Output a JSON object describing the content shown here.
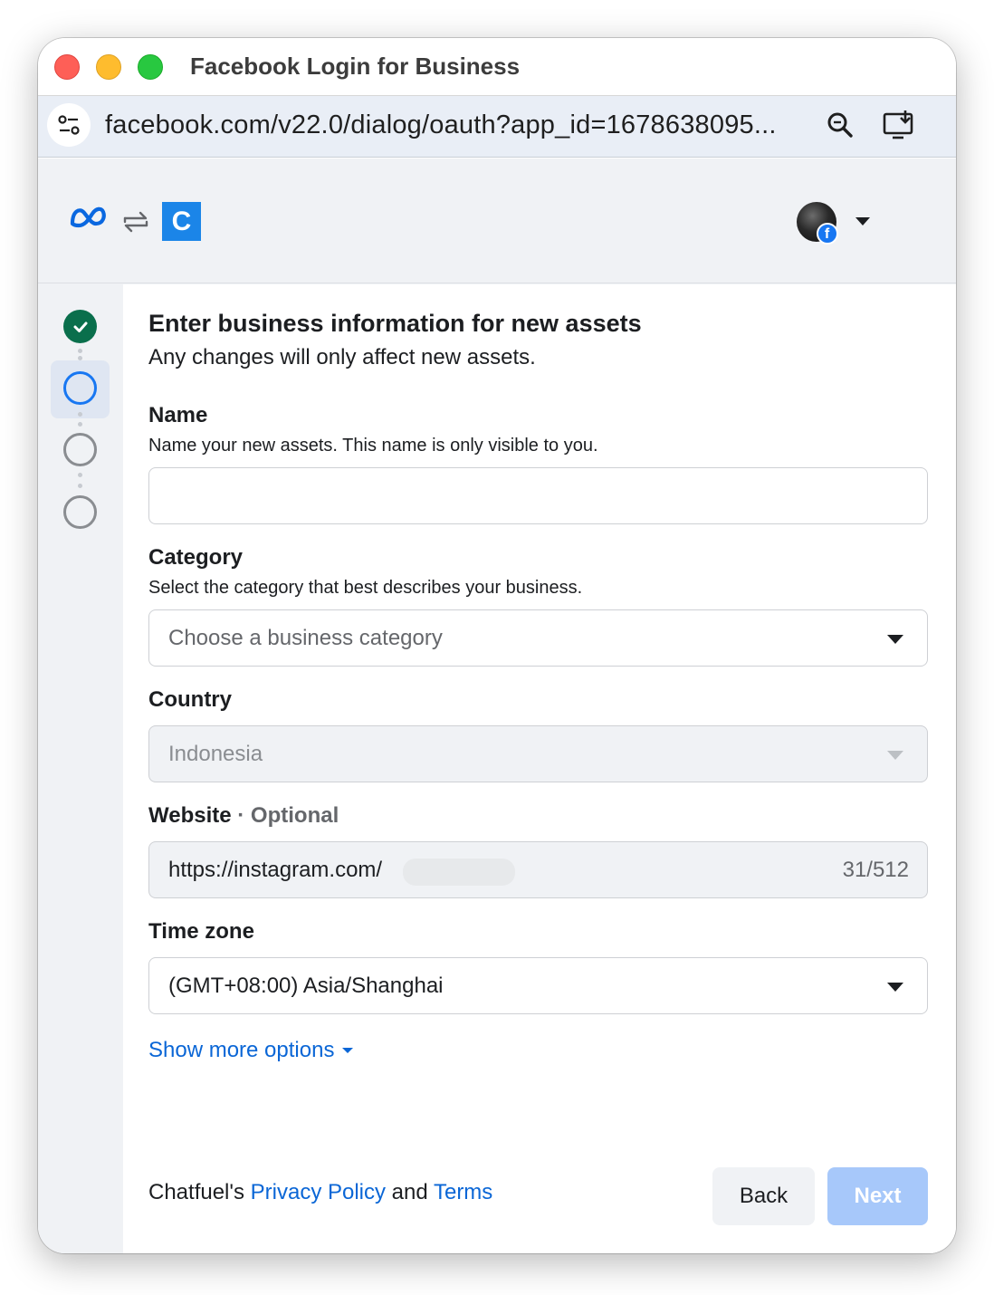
{
  "window": {
    "title": "Facebook Login for Business",
    "url": "facebook.com/v22.0/dialog/oauth?app_id=1678638095..."
  },
  "header": {
    "app_logo_letter": "C"
  },
  "form": {
    "heading": "Enter business information for new assets",
    "subheading": "Any changes will only affect new assets.",
    "name": {
      "label": "Name",
      "help": "Name your new assets. This name is only visible to you.",
      "value": ""
    },
    "category": {
      "label": "Category",
      "help": "Select the category that best describes your business.",
      "placeholder": "Choose a business category"
    },
    "country": {
      "label": "Country",
      "value": "Indonesia"
    },
    "website": {
      "label": "Website",
      "separator": " · ",
      "optional": "Optional",
      "value": "https://instagram.com/",
      "counter": "31/512"
    },
    "timezone": {
      "label": "Time zone",
      "value": "(GMT+08:00) Asia/Shanghai"
    },
    "show_more": "Show more options"
  },
  "footer": {
    "prefix": "Chatfuel's ",
    "privacy": "Privacy Policy",
    "and": " and ",
    "terms": "Terms",
    "back": "Back",
    "next": "Next"
  },
  "steps": {
    "total": 4,
    "completed": 1,
    "current": 2
  },
  "colors": {
    "brand_blue": "#1877f2",
    "link_blue": "#0a66d6",
    "step_done": "#0a6f4c",
    "next_disabled": "#a7c8fa"
  }
}
